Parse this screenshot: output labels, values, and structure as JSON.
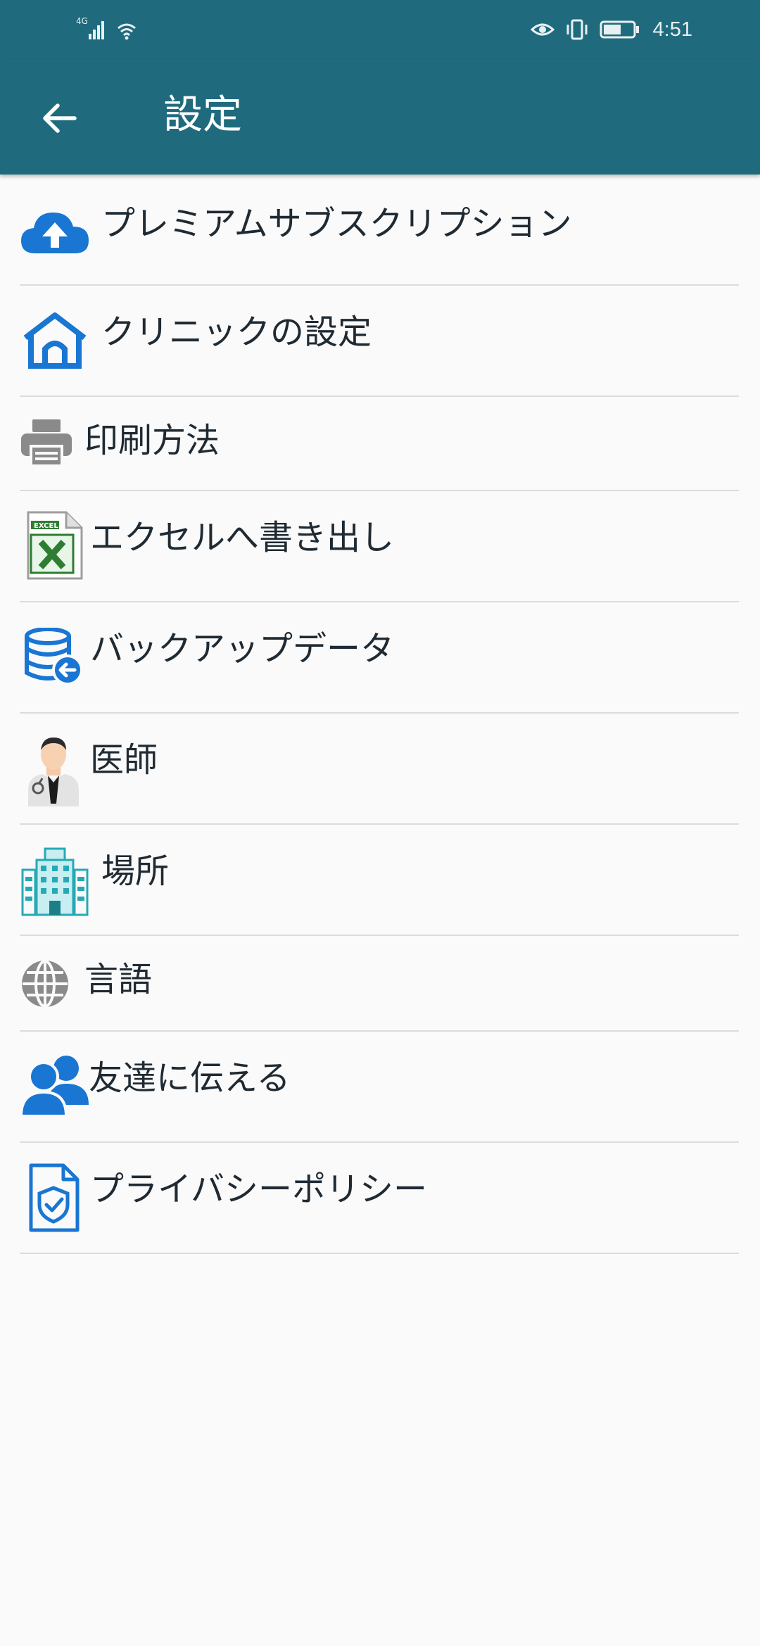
{
  "status_bar": {
    "network": "4G",
    "time": "4:51"
  },
  "app_bar": {
    "title": "設定",
    "back_icon": "arrow-left-icon"
  },
  "settings": {
    "items": [
      {
        "label": "プレミアムサブスクリプション",
        "icon": "cloud-upload-icon"
      },
      {
        "label": "クリニックの設定",
        "icon": "home-icon"
      },
      {
        "label": "印刷方法",
        "icon": "printer-icon"
      },
      {
        "label": "エクセルへ書き出し",
        "icon": "excel-icon"
      },
      {
        "label": "バックアップデータ",
        "icon": "database-backup-icon"
      },
      {
        "label": "医師",
        "icon": "doctor-icon"
      },
      {
        "label": "場所",
        "icon": "building-icon"
      },
      {
        "label": "言語",
        "icon": "globe-icon"
      },
      {
        "label": "友達に伝える",
        "icon": "users-icon"
      },
      {
        "label": "プライバシーポリシー",
        "icon": "privacy-shield-icon"
      }
    ]
  },
  "colors": {
    "primary": "#1f6b7d",
    "accent_blue": "#1976d2",
    "icon_gray": "#8a8a8a",
    "teal": "#26a9b5",
    "excel_green": "#2e7d32",
    "background": "#fafafa",
    "divider": "#dcdcdc"
  }
}
